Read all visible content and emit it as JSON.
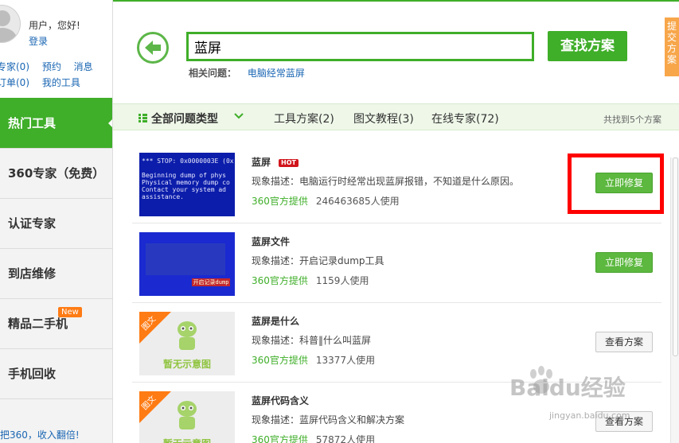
{
  "user": {
    "greeting": "用户，您好!",
    "login": "登录",
    "links_row1": [
      "专家(0)",
      "预约",
      "消息"
    ],
    "links_row2": [
      "订单(0)",
      "我的工具"
    ]
  },
  "sidebar": {
    "items": [
      {
        "label": "热门工具",
        "active": true
      },
      {
        "label": "360专家（免费）"
      },
      {
        "label": "认证专家"
      },
      {
        "label": "到店维修"
      },
      {
        "label": "精品二手机",
        "badge": "New"
      },
      {
        "label": "手机回收"
      }
    ],
    "footer": "把360，收入翻倍!"
  },
  "search": {
    "query": "蓝屏",
    "button": "查找方案",
    "related_label": "相关问题：",
    "related_link": "电脑经常蓝屏"
  },
  "feedback_tab": "提交方案",
  "filters": {
    "all": "全部问题类型",
    "tabs": [
      "工具方案(2)",
      "图文教程(3)",
      "在线专家(72)"
    ],
    "total": "共找到5个方案"
  },
  "results": [
    {
      "title": "蓝屏",
      "badge": "HOT",
      "desc": "现象描述：电脑运行时经常出现蓝屏报错，不知道是什么原因。",
      "source": "360官方提供",
      "users": "246463685人使用",
      "action": "立即修复",
      "thumb_text": "*** STOP: 0x0000003E (0x\n\nBeginning dump of phys\nPhysical memory dump co\nContact your system ad\nassistance."
    },
    {
      "title": "蓝屏文件",
      "desc": "现象描述：开启记录dump工具",
      "source": "360官方提供",
      "users": "1159人使用",
      "action": "立即修复",
      "thumb_red": "开启记录dump"
    },
    {
      "title": "蓝屏是什么",
      "desc": "现象描述：科普‖什么叫蓝屏",
      "source": "360官方提供",
      "users": "13377人使用",
      "action": "查看方案",
      "corner": "图文",
      "caption": "暂无示意图"
    },
    {
      "title": "蓝屏代码含义",
      "desc": "现象描述：蓝屏代码含义和解决方案",
      "source": "360官方提供",
      "users": "57872人使用",
      "action": "查看方案",
      "corner": "图文",
      "caption": "暂无示意图"
    }
  ],
  "watermark": {
    "logo": "Baidu经验",
    "url": "jingyan.baidu.com"
  },
  "colors": {
    "accent": "#3fae29",
    "link": "#1a66b3",
    "highlight": "#ff0000",
    "badge": "#ff7b14"
  }
}
